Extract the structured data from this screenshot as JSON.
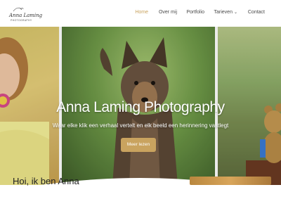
{
  "logo": {
    "script_text": "Anna Laming",
    "sub_text": "PHOTOGRAPHY"
  },
  "nav": {
    "items": [
      {
        "label": "Home",
        "active": true
      },
      {
        "label": "Over mij",
        "active": false
      },
      {
        "label": "Portfolio",
        "active": false
      },
      {
        "label": "Tarieven",
        "active": false,
        "has_dropdown": true
      },
      {
        "label": "Contact",
        "active": false
      }
    ],
    "dropdown_icon": "chevron-down-icon"
  },
  "hero": {
    "title": "Anna Laming Photography",
    "subtitle": "Waar elke klik een verhaal vertelt en elk beeld een herinnering vastlegt",
    "button_label": "Meer lezen"
  },
  "section": {
    "heading": "Hoi, ik ben Anna"
  },
  "colors": {
    "accent": "#c9a35f",
    "nav_text": "#4a4a4a",
    "background": "#ffffff"
  }
}
